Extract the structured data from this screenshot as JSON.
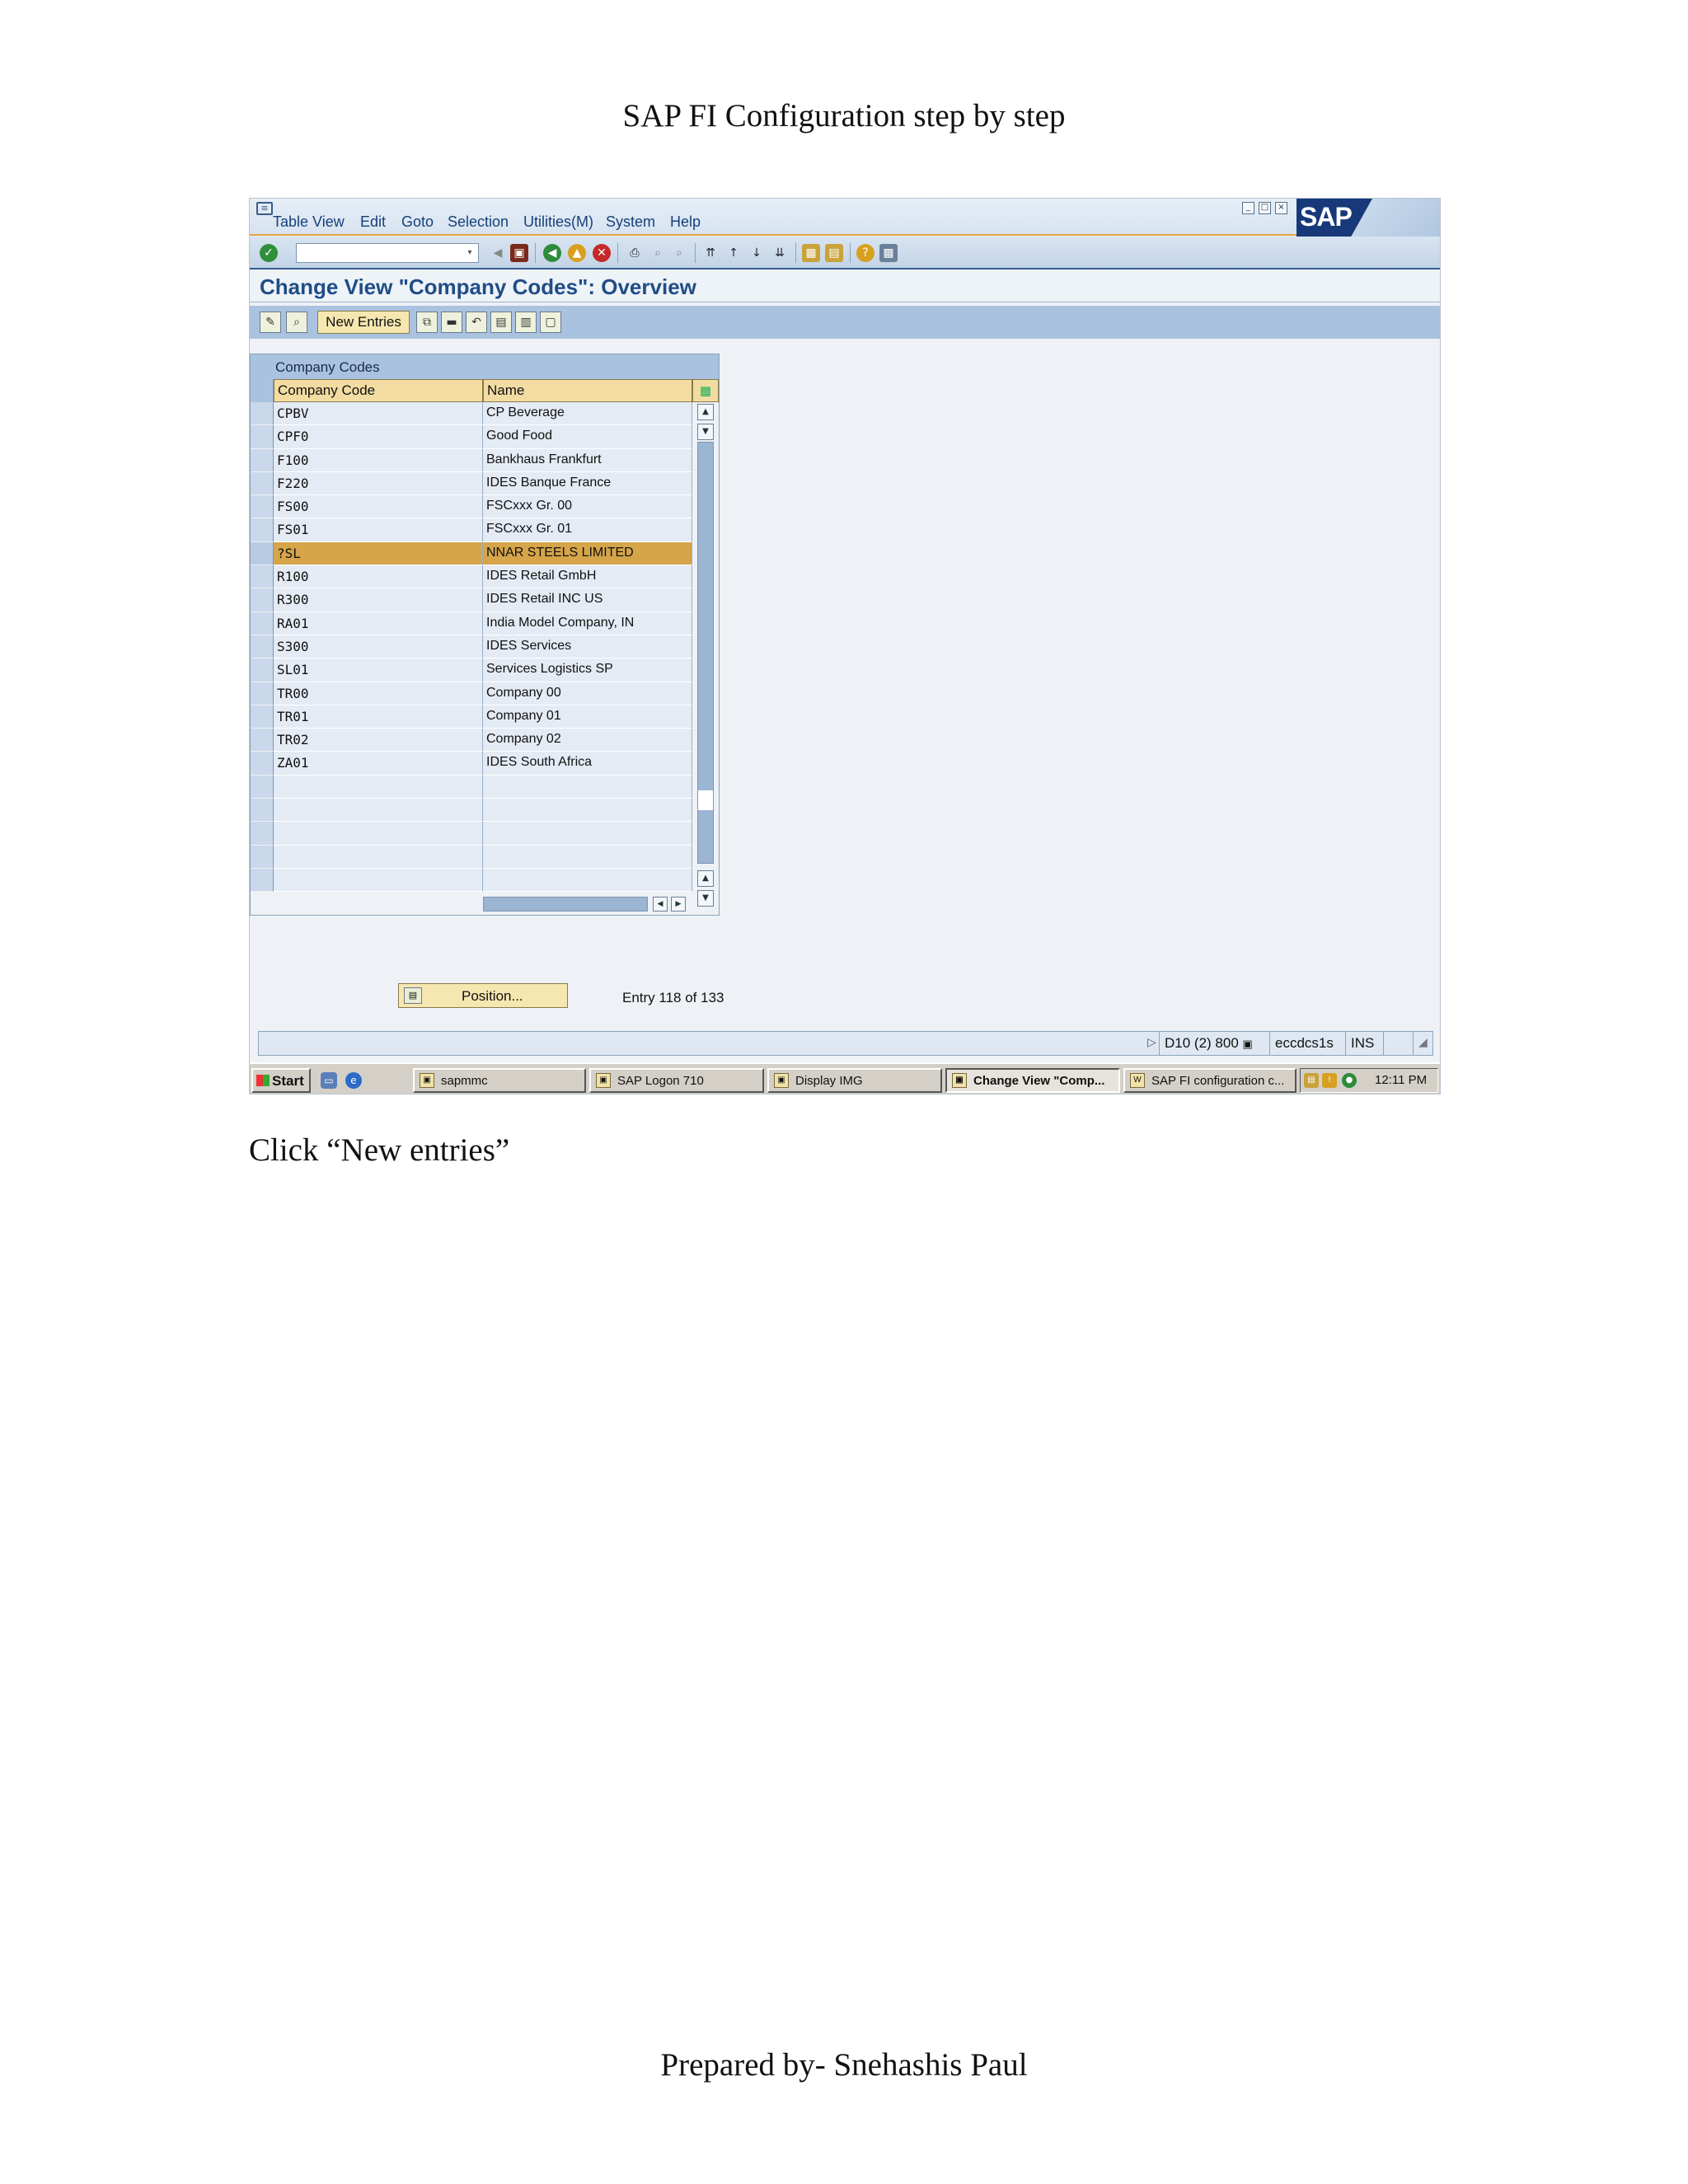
{
  "document": {
    "header": "SAP FI Configuration step by step",
    "instruction": "Click “New entries”",
    "footer": "Prepared by- Snehashis Paul"
  },
  "menu": [
    "Table View",
    "Edit",
    "Goto",
    "Selection",
    "Utilities(M)",
    "System",
    "Help"
  ],
  "logo": "SAP",
  "screen": {
    "title": "Change View \"Company Codes\": Overview",
    "new_entries_label": "New Entries"
  },
  "table": {
    "caption": "Company Codes",
    "columns": [
      "Company Code",
      "Name"
    ],
    "rows": [
      {
        "code": "CPBV",
        "name": "CP Beverage"
      },
      {
        "code": "CPF0",
        "name": "Good Food"
      },
      {
        "code": "F100",
        "name": "Bankhaus Frankfurt"
      },
      {
        "code": "F220",
        "name": "IDES  Banque France"
      },
      {
        "code": "FS00",
        "name": "FSCxxx Gr. 00"
      },
      {
        "code": "FS01",
        "name": "FSCxxx Gr. 01"
      },
      {
        "code": "?SL",
        "name": "NNAR STEELS LIMITED"
      },
      {
        "code": "R100",
        "name": "IDES Retail GmbH"
      },
      {
        "code": "R300",
        "name": "IDES Retail INC US"
      },
      {
        "code": "RA01",
        "name": "India Model Company, IN"
      },
      {
        "code": "S300",
        "name": "IDES Services"
      },
      {
        "code": "SL01",
        "name": "Services Logistics SP"
      },
      {
        "code": "TR00",
        "name": "Company 00"
      },
      {
        "code": "TR01",
        "name": "Company 01"
      },
      {
        "code": "TR02",
        "name": "Company 02"
      },
      {
        "code": "ZA01",
        "name": "IDES South Africa"
      },
      {
        "code": "",
        "name": ""
      },
      {
        "code": "",
        "name": ""
      },
      {
        "code": "",
        "name": ""
      },
      {
        "code": "",
        "name": ""
      },
      {
        "code": "",
        "name": ""
      }
    ],
    "selected_row": 6
  },
  "position_label": "Position...",
  "entry_info": "Entry 118 of 133",
  "status": {
    "system": "D10 (2) 800",
    "server": "eccdcs1s",
    "mode": "INS"
  },
  "taskbar": {
    "start": "Start",
    "items": [
      "sapmmc",
      "SAP Logon 710",
      "Display IMG",
      "Change View \"Comp...",
      "SAP FI configuration c..."
    ],
    "active_index": 3,
    "clock": "12:11 PM"
  }
}
